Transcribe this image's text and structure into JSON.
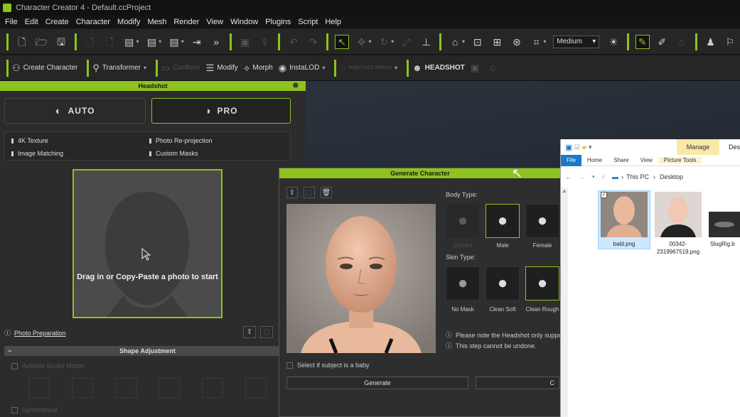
{
  "window": {
    "title": "Character Creator 4 - Default.ccProject"
  },
  "menu": [
    "File",
    "Edit",
    "Create",
    "Character",
    "Modify",
    "Mesh",
    "Render",
    "View",
    "Window",
    "Plugins",
    "Script",
    "Help"
  ],
  "toolbar1": {
    "quality": "Medium"
  },
  "toolbar2": {
    "create_character": "Create Character",
    "transformer": "Transformer",
    "conform": "Conform",
    "modify": "Modify",
    "morph": "Morph",
    "instalod": "InstaLOD",
    "substance": "SUBSTANCE BRIDGE",
    "headshot": "HEADSHOT"
  },
  "headshot": {
    "title": "Headshot",
    "mode_auto": "AUTO",
    "mode_pro": "PRO",
    "features": [
      "4K Texture",
      "Photo Re-projection",
      "Image Matching",
      "Custom Masks"
    ],
    "drop_text": "Drag in or Copy-Paste a photo to start",
    "photo_prep": "Photo Preparation",
    "shape_title": "Shape Adjustment",
    "activate_morph": "Activate Sculpt Morph",
    "symmetrical": "Symmetrical"
  },
  "generate": {
    "title": "Generate Character",
    "body_type_label": "Body Type:",
    "body_types": [
      "Current",
      "Male",
      "Female"
    ],
    "skin_type_label": "Skin Type:",
    "skin_types": [
      "No Mask",
      "Clean Soft",
      "Clean Rough"
    ],
    "note1": "Please note the Headshot only suppo",
    "note2": "This step cannot be undone.",
    "baby_label": "Select if subject is a baby",
    "generate_btn": "Generate",
    "cancel_btn": "C"
  },
  "explorer": {
    "manage": "Manage",
    "title_right": "Desk",
    "tabs": [
      "File",
      "Home",
      "Share",
      "View",
      "Picture Tools"
    ],
    "path": [
      "This PC",
      "Desktop"
    ],
    "files": [
      "bald.png",
      "00342-2319967519.png",
      "SlugRig.b"
    ]
  },
  "colors": {
    "accent": "#8dc21f"
  }
}
